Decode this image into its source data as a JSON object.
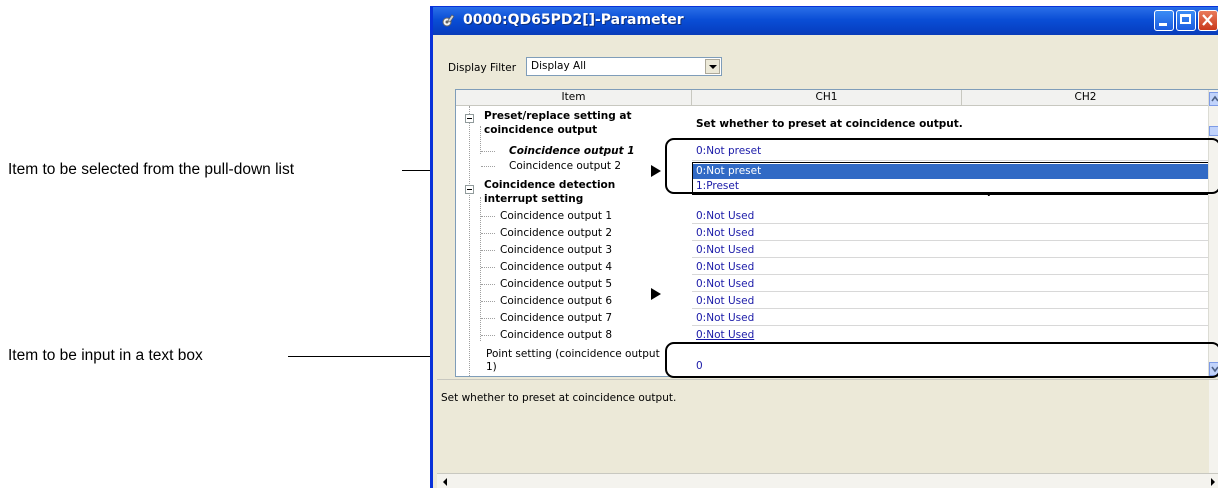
{
  "annotations": {
    "pulldown": "Item to be selected from the pull-down list",
    "textbox": "Item to be input in a text box"
  },
  "window": {
    "title": "0000:QD65PD2[]-Parameter",
    "icon": "gear-wrench-icon"
  },
  "filter": {
    "label": "Display Filter",
    "value": "Display All"
  },
  "grid": {
    "headers": {
      "item": "Item",
      "ch1": "CH1",
      "ch2": "CH2"
    },
    "sections": [
      {
        "title_line1": "Preset/replace setting at",
        "title_line2": "coincidence output",
        "description": "Set whether to preset at coincidence output."
      },
      {
        "title_line1": "Coincidence detection",
        "title_line2": "interrupt setting",
        "description": "Set whether to use coincidence detection interrupt."
      }
    ],
    "preset_rows": [
      "Coincidence output 1",
      "Coincidence output 2"
    ],
    "preset_value": "0:Not preset",
    "preset_options": [
      "0:Not preset",
      "1:Preset"
    ],
    "interrupt_rows": [
      "Coincidence output 1",
      "Coincidence output 2",
      "Coincidence output 3",
      "Coincidence output 4",
      "Coincidence output 5",
      "Coincidence output 6",
      "Coincidence output 7",
      "Coincidence output 8"
    ],
    "interrupt_values": [
      "0:Not Used",
      "0:Not Used",
      "0:Not Used",
      "0:Not Used",
      "0:Not Used",
      "0:Not Used",
      "0:Not Used",
      "0:Not Used"
    ],
    "point_row_line1": "Point setting (coincidence output",
    "point_row_line2": "1)",
    "point_value": "0"
  },
  "description_pane": {
    "text": "Set whether to preset at coincidence output."
  }
}
